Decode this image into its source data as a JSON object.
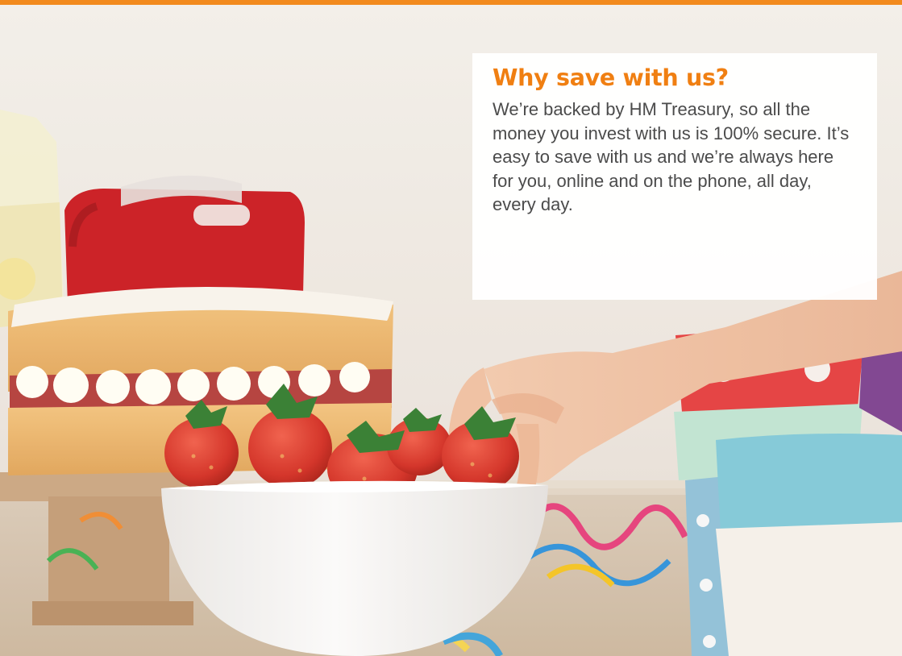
{
  "colors": {
    "brand_orange": "#f28a1d",
    "heading_orange": "#f07f12",
    "body_text": "#4b4b4b",
    "card_background": "#ffffff"
  },
  "hero_image": {
    "icon": "cake-strawberries-party-photo"
  },
  "info_card": {
    "title": "Why save with us?",
    "body": "We’re backed by HM Treasury, so all the money you invest with us is 100% secure. It’s easy to save with us and we’re always here for you, online and on the phone, all day, every day."
  }
}
